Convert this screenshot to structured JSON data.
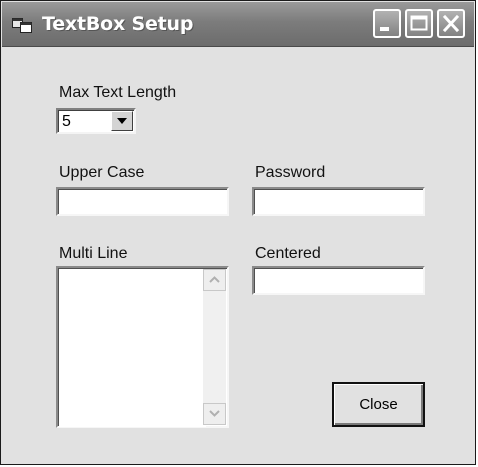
{
  "window": {
    "title": "TextBox Setup",
    "icon": "app-window-icon",
    "controls": {
      "minimize_icon": "minimize-icon",
      "maximize_icon": "maximize-icon",
      "close_icon": "close-icon"
    }
  },
  "form": {
    "max_text_length": {
      "label": "Max Text Length",
      "selected": "5",
      "dropdown_icon": "chevron-down-icon"
    },
    "upper_case": {
      "label": "Upper Case",
      "value": ""
    },
    "password": {
      "label": "Password",
      "value": ""
    },
    "multi_line": {
      "label": "Multi Line",
      "value": ""
    },
    "centered": {
      "label": "Centered",
      "value": ""
    },
    "close_button": {
      "label": "Close"
    }
  },
  "colors": {
    "window_background": "#e1e1e1",
    "titlebar": "#7c7c7c",
    "title_text": "#ffffff",
    "field_background": "#ffffff"
  }
}
